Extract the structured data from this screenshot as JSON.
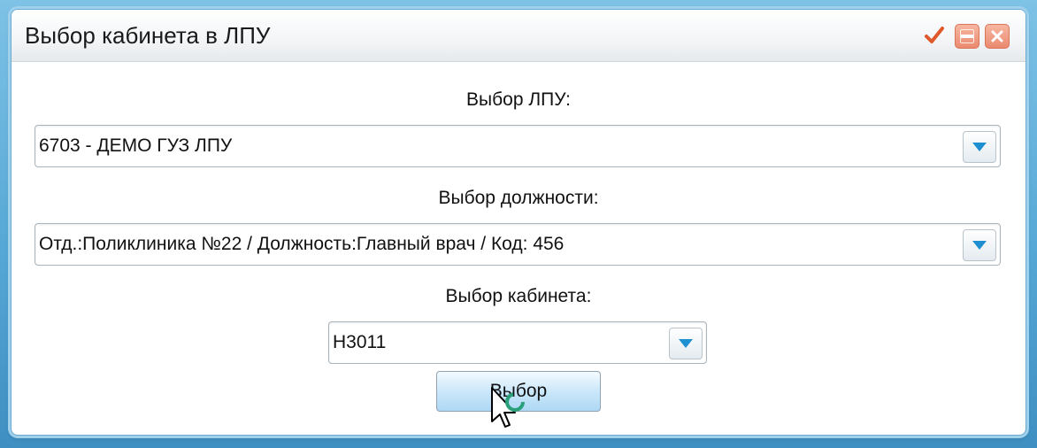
{
  "window": {
    "title": "Выбор кабинета в ЛПУ",
    "buttons": [
      "check-icon",
      "minimize-icon",
      "close-icon"
    ]
  },
  "lpu": {
    "label": "Выбор ЛПУ:",
    "value": "6703 - ДЕМО ГУЗ ЛПУ"
  },
  "post": {
    "label": "Выбор должности:",
    "value": "Отд.:Поликлиника №22 / Должность:Главный врач / Код: 456"
  },
  "cabinet": {
    "label": "Выбор кабинета:",
    "value": "Н3011"
  },
  "actions": {
    "select_label": "Выбор"
  },
  "colors": {
    "accent": "#1e8fd0",
    "title_button": "#ea8a6f",
    "check": "#e0582a"
  }
}
